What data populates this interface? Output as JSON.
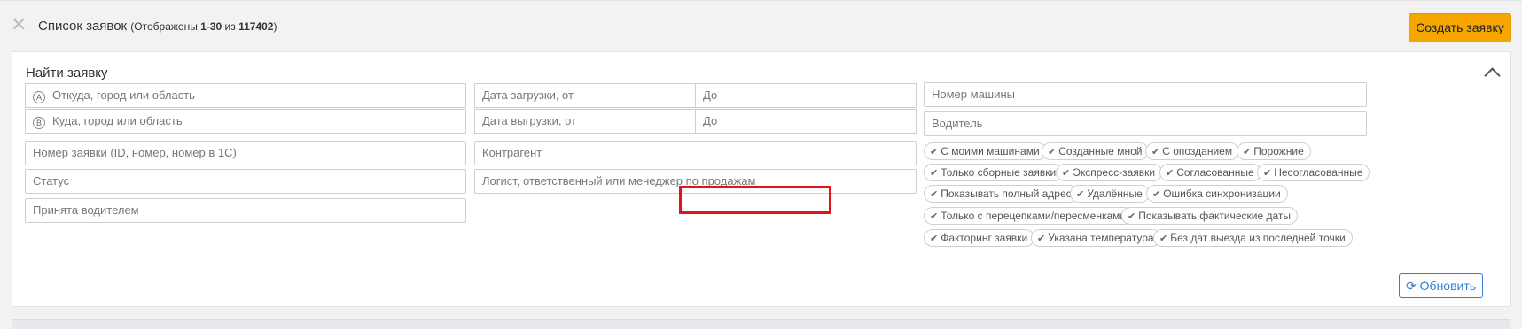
{
  "header": {
    "title": "Список заявок",
    "shown_prefix": "(Отображены ",
    "shown_range": "1-30",
    "shown_of": " из ",
    "shown_total": "117402",
    "shown_suffix": ")",
    "create_button": "Создать заявку"
  },
  "search": {
    "title": "Найти заявку",
    "from_icon": "A",
    "from_placeholder": "Откуда, город или область",
    "to_icon": "B",
    "to_placeholder": "Куда, город или область",
    "load_from": "Дата загрузки, от",
    "load_to": "До",
    "unload_from": "Дата выгрузки, от",
    "unload_to": "До",
    "car_number": "Номер машины",
    "driver": "Водитель",
    "order_number": "Номер заявки (ID, номер, номер в 1С)",
    "counterparty": "Контрагент",
    "status": "Статус",
    "logist": "Логист, ответственный или менеджер по продажам",
    "accepted_by_driver": "Принята водителем",
    "refresh_button": "Обновить",
    "filters": [
      "С моими машинами",
      "Созданные мной",
      "С опозданием",
      "Порожние",
      "Только сборные заявки",
      "Экспресс-заявки",
      "Согласованные",
      "Несогласованные",
      "Показывать полный адрес",
      "Удалённые",
      "Ошибка синхронизации",
      "Только с перецепками/пересменками",
      "Показывать фактические даты",
      "Факторинг заявки",
      "Указана температура",
      "Без дат выезда из последней точки"
    ]
  },
  "icons": {
    "close": "close-icon",
    "collapse": "chevron-up-icon",
    "check": "check-icon",
    "refresh": "refresh-icon"
  },
  "colors": {
    "accent_orange": "#f7a600",
    "link_blue": "#2f7fd3",
    "highlight_red": "#e0141b"
  }
}
